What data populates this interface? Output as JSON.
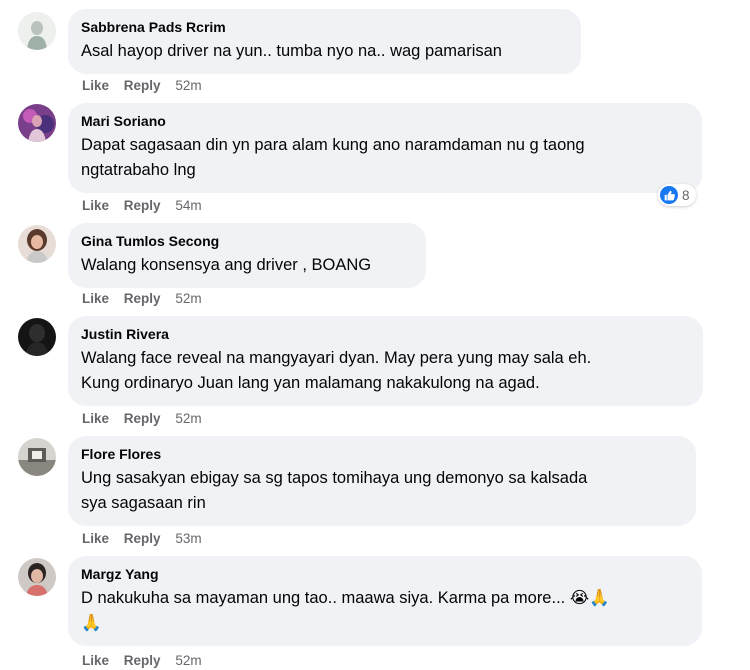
{
  "comments": [
    {
      "author": "Sabbrena Pads Rcrim",
      "text": "Asal hayop driver na yun.. tumba nyo na.. wag pamarisan",
      "like": "Like",
      "reply": "Reply",
      "time": "52m"
    },
    {
      "author": "Mari Soriano",
      "text": "Dapat sagasaan din yn para alam kung ano naramdaman nu g taong\nngtatrabaho lng",
      "like": "Like",
      "reply": "Reply",
      "time": "54m",
      "reaction_count": "8",
      "reaction_icon": "like-icon"
    },
    {
      "author": "Gina Tumlos Secong",
      "text": "Walang konsensya ang driver , BOANG",
      "like": "Like",
      "reply": "Reply",
      "time": "52m"
    },
    {
      "author": "Justin Rivera",
      "text": "Walang face reveal na mangyayari dyan. May pera yung may sala eh.\nKung ordinaryo Juan lang yan malamang nakakulong na agad.",
      "like": "Like",
      "reply": "Reply",
      "time": "52m"
    },
    {
      "author": "Flore Flores",
      "text": "Ung sasakyan ebigay sa sg tapos tomihaya ung demonyo sa kalsada\nsya sagasaan rin",
      "like": "Like",
      "reply": "Reply",
      "time": "53m"
    },
    {
      "author": "Margz Yang",
      "text": "D nakukuha sa mayaman ung tao.. maawa siya. Karma pa more... 😭🙏\n🙏",
      "like": "Like",
      "reply": "Reply",
      "time": "52m"
    }
  ],
  "colors": {
    "bubble": "#f0f2f5",
    "meta_text": "#65676b",
    "like_blue": "#1877f2"
  }
}
